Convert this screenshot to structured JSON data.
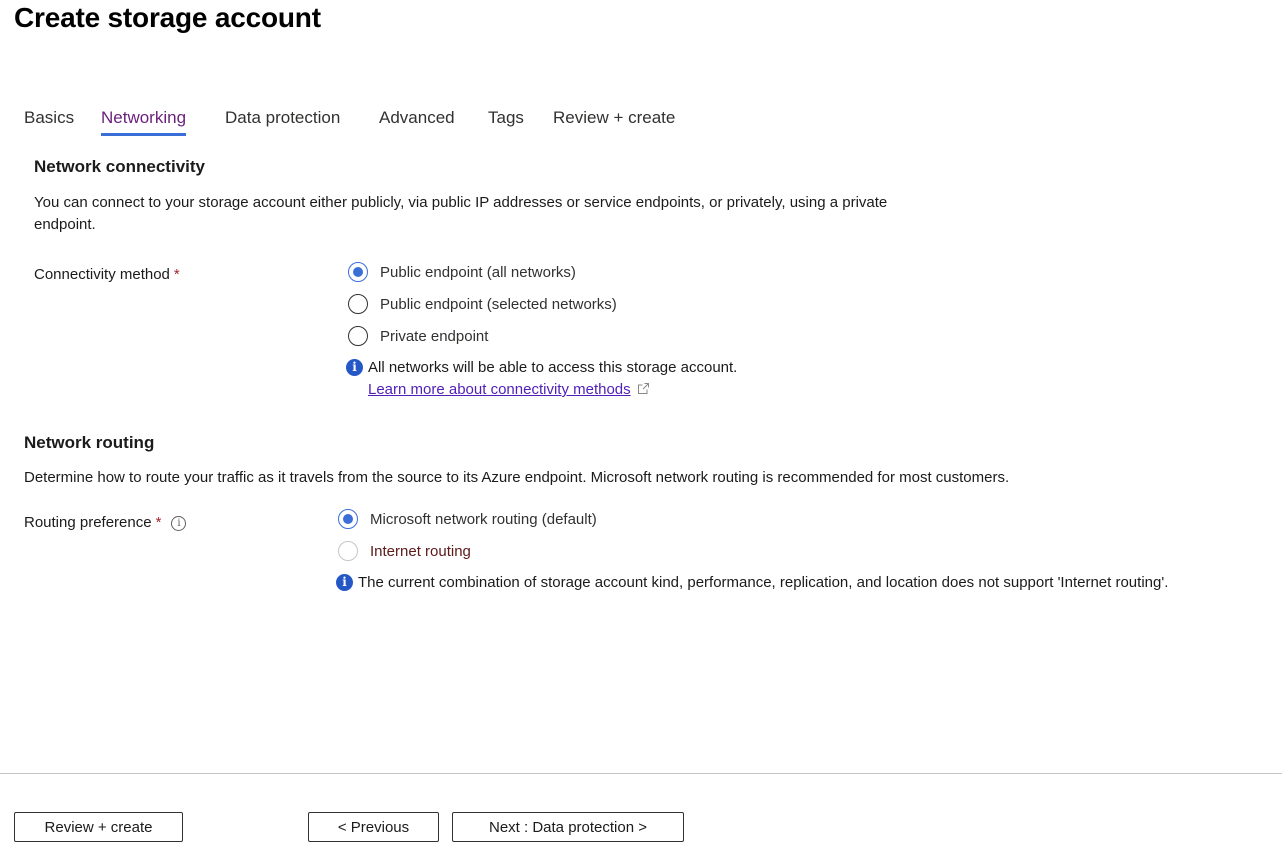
{
  "page": {
    "title": "Create storage account"
  },
  "tabs": [
    {
      "label": "Basics",
      "active": false
    },
    {
      "label": "Networking",
      "active": true
    },
    {
      "label": "Data protection",
      "active": false
    },
    {
      "label": "Advanced",
      "active": false
    },
    {
      "label": "Tags",
      "active": false
    },
    {
      "label": "Review + create",
      "active": false
    }
  ],
  "network_connectivity": {
    "title": "Network connectivity",
    "description": "You can connect to your storage account either publicly, via public IP addresses or service endpoints, or privately, using a private endpoint.",
    "field_label": "Connectivity method",
    "required_marker": "*",
    "options": [
      {
        "label": "Public endpoint (all networks)",
        "checked": true,
        "disabled": false
      },
      {
        "label": "Public endpoint (selected networks)",
        "checked": false,
        "disabled": false
      },
      {
        "label": "Private endpoint",
        "checked": false,
        "disabled": false
      }
    ],
    "info_icon": "info-filled-icon",
    "info_text": "All networks will be able to access this storage account.",
    "learn_more_link": "Learn more about connectivity methods",
    "link_icon": "external-link-icon"
  },
  "network_routing": {
    "title": "Network routing",
    "description": "Determine how to route your traffic as it travels from the source to its Azure endpoint. Microsoft network routing is recommended for most customers.",
    "field_label": "Routing preference",
    "required_marker": "*",
    "tooltip_icon": "info-outline-icon",
    "tooltip_glyph": "i",
    "options": [
      {
        "label": "Microsoft network routing (default)",
        "checked": true,
        "disabled": false
      },
      {
        "label": "Internet routing",
        "checked": false,
        "disabled": true
      }
    ],
    "info_icon": "info-filled-icon",
    "info_glyph": "i",
    "info_text": "The current combination of storage account kind, performance, replication, and location does not support 'Internet routing'."
  },
  "footer": {
    "review_create_label": "Review + create",
    "previous_label": "< Previous",
    "next_label": "Next : Data protection >"
  },
  "colors": {
    "accent": "#3a6fd8",
    "active_tab_text": "#6b1f7c",
    "required": "#a4262c",
    "link": "#4f1fb8",
    "info_icon": "#2458c6"
  }
}
